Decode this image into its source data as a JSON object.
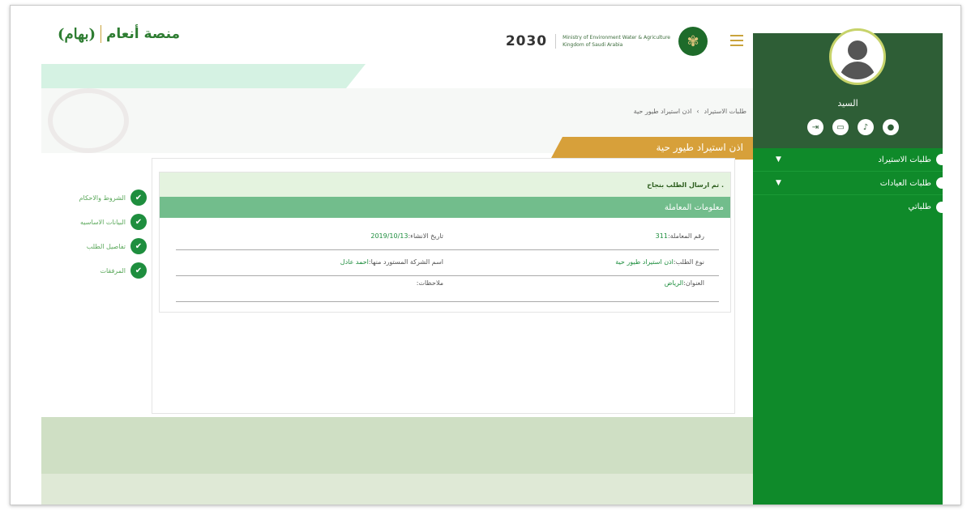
{
  "brand": {
    "platform_name": "منصة أنعام",
    "logo_text": "(بهام)"
  },
  "ministry": {
    "vision": "2030",
    "ministry_en": "Ministry of Environment Water & Agriculture",
    "ministry_sub": "Kingdom of Saudi Arabia"
  },
  "sidebar": {
    "user_name": "السيد",
    "icons": [
      "logout-icon",
      "card-icon",
      "bell-icon",
      "chat-icon"
    ],
    "items": [
      {
        "label": "طلبات الاستيراد",
        "has_chevron": true
      },
      {
        "label": "طلبات العيادات",
        "has_chevron": true
      },
      {
        "label": "طلباتي",
        "has_chevron": false
      }
    ]
  },
  "breadcrumb": {
    "items": [
      "طلبات الاستيراد",
      "اذن استيراد طيور حية"
    ],
    "separator": "›"
  },
  "page_title": "اذن استيراد طيور حية",
  "success_message": "تم ارسال الطلب بنجاح .",
  "section_title": "معلومات المعاملة",
  "fields": {
    "transaction_no_label": "رقم المعاملة:",
    "transaction_no": "311",
    "created_label": "تاريخ الانشاء:",
    "created_date": "2019/10/13",
    "request_type_label": "نوع الطلب:",
    "request_type": "اذن استيراد طيور حية",
    "company_label": "اسم الشركة المستورد منها:",
    "company": "احمد عادل",
    "address_label": "العنوان:",
    "address": "الرياض",
    "notes_label": "ملاحظات:"
  },
  "steps": [
    {
      "label": "الشروط والاحكام"
    },
    {
      "label": "البيانات الاساسيه"
    },
    {
      "label": "تفاصيل الطلب"
    },
    {
      "label": "المرفقات"
    }
  ],
  "colors": {
    "sidebar_green": "#0f8a2a",
    "sidebar_head": "#2e5e36",
    "title_gold": "#d7a03a",
    "section_green": "#72bd8c",
    "value_green": "#1e8e3e"
  }
}
